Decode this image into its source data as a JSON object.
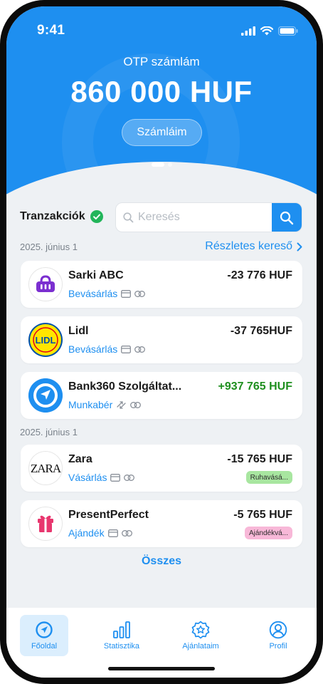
{
  "status": {
    "time": "9:41"
  },
  "header": {
    "account_label": "OTP számlám",
    "balance": "860 000 HUF",
    "accounts_button": "Számláim"
  },
  "transactions": {
    "title": "Tranzakciók",
    "search_placeholder": "Keresés",
    "detail_search_link": "Részletes kereső",
    "all_link": "Összes",
    "groups": [
      {
        "date": "2025. június 1",
        "items": [
          {
            "merchant": "Sarki ABC",
            "category": "Bevásárlás",
            "amount": "-23 776 HUF"
          },
          {
            "merchant": "Lidl",
            "category": "Bevásárlás",
            "amount": "-37 765HUF"
          },
          {
            "merchant": "Bank360 Szolgáltat...",
            "category": "Munkabér",
            "amount": "+937 765 HUF"
          }
        ]
      },
      {
        "date": "2025. június 1",
        "items": [
          {
            "merchant": "Zara",
            "category": "Vásárlás",
            "amount": "-15 765 HUF",
            "tag": "Ruhavásá..."
          },
          {
            "merchant": "PresentPerfect",
            "category": "Ajándék",
            "amount": "-5 765 HUF",
            "tag": "Ajándékvá..."
          }
        ]
      }
    ],
    "logos": {
      "lidl_text": "LIDL",
      "zara_text": "ZARA"
    }
  },
  "nav": [
    {
      "label": "Főoldal",
      "icon": "compass-icon",
      "active": true
    },
    {
      "label": "Statisztika",
      "icon": "bar-chart-icon",
      "active": false
    },
    {
      "label": "Ajánlataim",
      "icon": "offer-badge-icon",
      "active": false
    },
    {
      "label": "Profil",
      "icon": "user-icon",
      "active": false
    }
  ],
  "colors": {
    "primary": "#1e8ff0",
    "positive": "#1f8f1f",
    "verified": "#22b55a",
    "tag_green": "#a8e6a0",
    "tag_pink": "#f8b8d8",
    "sarki_purple": "#7b2fd0",
    "gift_pink": "#e8366e"
  }
}
